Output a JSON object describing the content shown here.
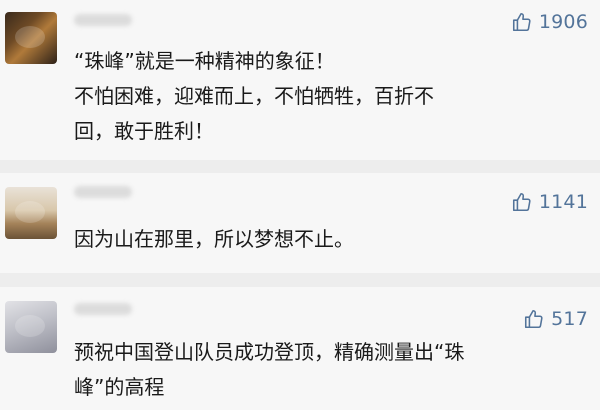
{
  "comments": [
    {
      "likes": "1906",
      "lines": [
        "“珠峰”就是一种精神的象征！",
        "不怕困难，迎难而上，不怕牺牲，百折不",
        "回，敢于胜利！"
      ]
    },
    {
      "likes": "1141",
      "lines": [
        "因为山在那里，所以梦想不止。"
      ]
    },
    {
      "likes": "517",
      "lines": [
        "预祝中国登山队员成功登顶，精确测量出“珠",
        "峰”的高程"
      ]
    }
  ],
  "icons": {
    "like": "thumbs-up-icon"
  },
  "colors": {
    "background": "#ededed",
    "card": "#f7f7f7",
    "like_accent": "#53749a",
    "text": "#1a1a1a"
  }
}
